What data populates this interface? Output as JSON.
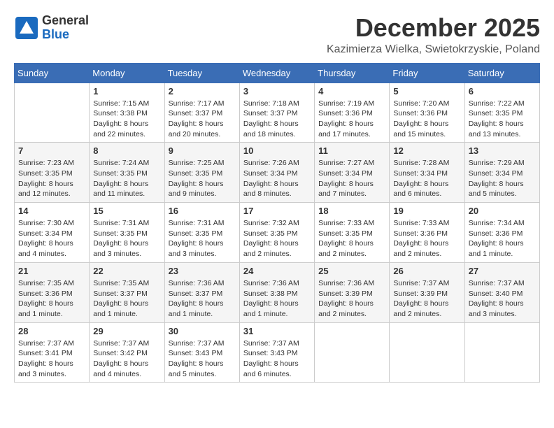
{
  "header": {
    "logo": {
      "general": "General",
      "blue": "Blue",
      "tagline": ""
    },
    "title": "December 2025",
    "location": "Kazimierza Wielka, Swietokrzyskie, Poland"
  },
  "weekdays": [
    "Sunday",
    "Monday",
    "Tuesday",
    "Wednesday",
    "Thursday",
    "Friday",
    "Saturday"
  ],
  "weeks": [
    [
      {
        "day": "",
        "info": ""
      },
      {
        "day": "1",
        "info": "Sunrise: 7:15 AM\nSunset: 3:38 PM\nDaylight: 8 hours\nand 22 minutes."
      },
      {
        "day": "2",
        "info": "Sunrise: 7:17 AM\nSunset: 3:37 PM\nDaylight: 8 hours\nand 20 minutes."
      },
      {
        "day": "3",
        "info": "Sunrise: 7:18 AM\nSunset: 3:37 PM\nDaylight: 8 hours\nand 18 minutes."
      },
      {
        "day": "4",
        "info": "Sunrise: 7:19 AM\nSunset: 3:36 PM\nDaylight: 8 hours\nand 17 minutes."
      },
      {
        "day": "5",
        "info": "Sunrise: 7:20 AM\nSunset: 3:36 PM\nDaylight: 8 hours\nand 15 minutes."
      },
      {
        "day": "6",
        "info": "Sunrise: 7:22 AM\nSunset: 3:35 PM\nDaylight: 8 hours\nand 13 minutes."
      }
    ],
    [
      {
        "day": "7",
        "info": "Sunrise: 7:23 AM\nSunset: 3:35 PM\nDaylight: 8 hours\nand 12 minutes."
      },
      {
        "day": "8",
        "info": "Sunrise: 7:24 AM\nSunset: 3:35 PM\nDaylight: 8 hours\nand 11 minutes."
      },
      {
        "day": "9",
        "info": "Sunrise: 7:25 AM\nSunset: 3:35 PM\nDaylight: 8 hours\nand 9 minutes."
      },
      {
        "day": "10",
        "info": "Sunrise: 7:26 AM\nSunset: 3:34 PM\nDaylight: 8 hours\nand 8 minutes."
      },
      {
        "day": "11",
        "info": "Sunrise: 7:27 AM\nSunset: 3:34 PM\nDaylight: 8 hours\nand 7 minutes."
      },
      {
        "day": "12",
        "info": "Sunrise: 7:28 AM\nSunset: 3:34 PM\nDaylight: 8 hours\nand 6 minutes."
      },
      {
        "day": "13",
        "info": "Sunrise: 7:29 AM\nSunset: 3:34 PM\nDaylight: 8 hours\nand 5 minutes."
      }
    ],
    [
      {
        "day": "14",
        "info": "Sunrise: 7:30 AM\nSunset: 3:34 PM\nDaylight: 8 hours\nand 4 minutes."
      },
      {
        "day": "15",
        "info": "Sunrise: 7:31 AM\nSunset: 3:35 PM\nDaylight: 8 hours\nand 3 minutes."
      },
      {
        "day": "16",
        "info": "Sunrise: 7:31 AM\nSunset: 3:35 PM\nDaylight: 8 hours\nand 3 minutes."
      },
      {
        "day": "17",
        "info": "Sunrise: 7:32 AM\nSunset: 3:35 PM\nDaylight: 8 hours\nand 2 minutes."
      },
      {
        "day": "18",
        "info": "Sunrise: 7:33 AM\nSunset: 3:35 PM\nDaylight: 8 hours\nand 2 minutes."
      },
      {
        "day": "19",
        "info": "Sunrise: 7:33 AM\nSunset: 3:36 PM\nDaylight: 8 hours\nand 2 minutes."
      },
      {
        "day": "20",
        "info": "Sunrise: 7:34 AM\nSunset: 3:36 PM\nDaylight: 8 hours\nand 1 minute."
      }
    ],
    [
      {
        "day": "21",
        "info": "Sunrise: 7:35 AM\nSunset: 3:36 PM\nDaylight: 8 hours\nand 1 minute."
      },
      {
        "day": "22",
        "info": "Sunrise: 7:35 AM\nSunset: 3:37 PM\nDaylight: 8 hours\nand 1 minute."
      },
      {
        "day": "23",
        "info": "Sunrise: 7:36 AM\nSunset: 3:37 PM\nDaylight: 8 hours\nand 1 minute."
      },
      {
        "day": "24",
        "info": "Sunrise: 7:36 AM\nSunset: 3:38 PM\nDaylight: 8 hours\nand 1 minute."
      },
      {
        "day": "25",
        "info": "Sunrise: 7:36 AM\nSunset: 3:39 PM\nDaylight: 8 hours\nand 2 minutes."
      },
      {
        "day": "26",
        "info": "Sunrise: 7:37 AM\nSunset: 3:39 PM\nDaylight: 8 hours\nand 2 minutes."
      },
      {
        "day": "27",
        "info": "Sunrise: 7:37 AM\nSunset: 3:40 PM\nDaylight: 8 hours\nand 3 minutes."
      }
    ],
    [
      {
        "day": "28",
        "info": "Sunrise: 7:37 AM\nSunset: 3:41 PM\nDaylight: 8 hours\nand 3 minutes."
      },
      {
        "day": "29",
        "info": "Sunrise: 7:37 AM\nSunset: 3:42 PM\nDaylight: 8 hours\nand 4 minutes."
      },
      {
        "day": "30",
        "info": "Sunrise: 7:37 AM\nSunset: 3:43 PM\nDaylight: 8 hours\nand 5 minutes."
      },
      {
        "day": "31",
        "info": "Sunrise: 7:37 AM\nSunset: 3:43 PM\nDaylight: 8 hours\nand 6 minutes."
      },
      {
        "day": "",
        "info": ""
      },
      {
        "day": "",
        "info": ""
      },
      {
        "day": "",
        "info": ""
      }
    ]
  ]
}
